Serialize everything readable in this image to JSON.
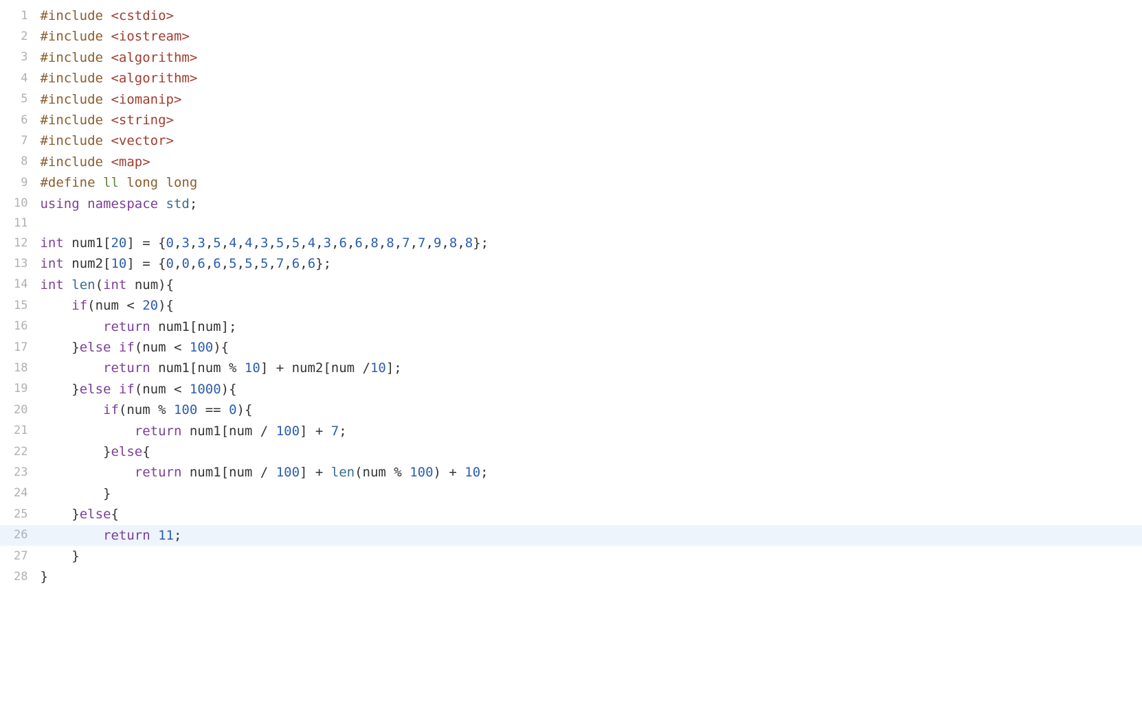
{
  "highlighted_line": 26,
  "lines": [
    {
      "n": 1,
      "tokens": [
        {
          "c": "tok-pp",
          "t": "#include "
        },
        {
          "c": "tok-inc",
          "t": "<cstdio>"
        }
      ]
    },
    {
      "n": 2,
      "tokens": [
        {
          "c": "tok-pp",
          "t": "#include "
        },
        {
          "c": "tok-inc",
          "t": "<iostream>"
        }
      ]
    },
    {
      "n": 3,
      "tokens": [
        {
          "c": "tok-pp",
          "t": "#include "
        },
        {
          "c": "tok-inc",
          "t": "<algorithm>"
        }
      ]
    },
    {
      "n": 4,
      "tokens": [
        {
          "c": "tok-pp",
          "t": "#include "
        },
        {
          "c": "tok-inc",
          "t": "<algorithm>"
        }
      ]
    },
    {
      "n": 5,
      "tokens": [
        {
          "c": "tok-pp",
          "t": "#include "
        },
        {
          "c": "tok-inc",
          "t": "<iomanip>"
        }
      ]
    },
    {
      "n": 6,
      "tokens": [
        {
          "c": "tok-pp",
          "t": "#include "
        },
        {
          "c": "tok-inc",
          "t": "<string>"
        }
      ]
    },
    {
      "n": 7,
      "tokens": [
        {
          "c": "tok-pp",
          "t": "#include "
        },
        {
          "c": "tok-inc",
          "t": "<vector>"
        }
      ]
    },
    {
      "n": 8,
      "tokens": [
        {
          "c": "tok-pp",
          "t": "#include "
        },
        {
          "c": "tok-inc",
          "t": "<map>"
        }
      ]
    },
    {
      "n": 9,
      "tokens": [
        {
          "c": "tok-pp",
          "t": "#define "
        },
        {
          "c": "tok-def",
          "t": "ll "
        },
        {
          "c": "tok-pp",
          "t": "long long"
        }
      ]
    },
    {
      "n": 10,
      "tokens": [
        {
          "c": "tok-kw",
          "t": "using"
        },
        {
          "c": "tok-id",
          "t": " "
        },
        {
          "c": "tok-kw",
          "t": "namespace"
        },
        {
          "c": "tok-id",
          "t": " "
        },
        {
          "c": "tok-fn",
          "t": "std"
        },
        {
          "c": "tok-punc",
          "t": ";"
        }
      ]
    },
    {
      "n": 11,
      "tokens": []
    },
    {
      "n": 12,
      "tokens": [
        {
          "c": "tok-type",
          "t": "int"
        },
        {
          "c": "tok-id",
          "t": " num1["
        },
        {
          "c": "tok-num",
          "t": "20"
        },
        {
          "c": "tok-id",
          "t": "] = {"
        },
        {
          "c": "tok-num",
          "t": "0"
        },
        {
          "c": "tok-punc",
          "t": ","
        },
        {
          "c": "tok-num",
          "t": "3"
        },
        {
          "c": "tok-punc",
          "t": ","
        },
        {
          "c": "tok-num",
          "t": "3"
        },
        {
          "c": "tok-punc",
          "t": ","
        },
        {
          "c": "tok-num",
          "t": "5"
        },
        {
          "c": "tok-punc",
          "t": ","
        },
        {
          "c": "tok-num",
          "t": "4"
        },
        {
          "c": "tok-punc",
          "t": ","
        },
        {
          "c": "tok-num",
          "t": "4"
        },
        {
          "c": "tok-punc",
          "t": ","
        },
        {
          "c": "tok-num",
          "t": "3"
        },
        {
          "c": "tok-punc",
          "t": ","
        },
        {
          "c": "tok-num",
          "t": "5"
        },
        {
          "c": "tok-punc",
          "t": ","
        },
        {
          "c": "tok-num",
          "t": "5"
        },
        {
          "c": "tok-punc",
          "t": ","
        },
        {
          "c": "tok-num",
          "t": "4"
        },
        {
          "c": "tok-punc",
          "t": ","
        },
        {
          "c": "tok-num",
          "t": "3"
        },
        {
          "c": "tok-punc",
          "t": ","
        },
        {
          "c": "tok-num",
          "t": "6"
        },
        {
          "c": "tok-punc",
          "t": ","
        },
        {
          "c": "tok-num",
          "t": "6"
        },
        {
          "c": "tok-punc",
          "t": ","
        },
        {
          "c": "tok-num",
          "t": "8"
        },
        {
          "c": "tok-punc",
          "t": ","
        },
        {
          "c": "tok-num",
          "t": "8"
        },
        {
          "c": "tok-punc",
          "t": ","
        },
        {
          "c": "tok-num",
          "t": "7"
        },
        {
          "c": "tok-punc",
          "t": ","
        },
        {
          "c": "tok-num",
          "t": "7"
        },
        {
          "c": "tok-punc",
          "t": ","
        },
        {
          "c": "tok-num",
          "t": "9"
        },
        {
          "c": "tok-punc",
          "t": ","
        },
        {
          "c": "tok-num",
          "t": "8"
        },
        {
          "c": "tok-punc",
          "t": ","
        },
        {
          "c": "tok-num",
          "t": "8"
        },
        {
          "c": "tok-id",
          "t": "};"
        }
      ]
    },
    {
      "n": 13,
      "tokens": [
        {
          "c": "tok-type",
          "t": "int"
        },
        {
          "c": "tok-id",
          "t": " num2["
        },
        {
          "c": "tok-num",
          "t": "10"
        },
        {
          "c": "tok-id",
          "t": "] = {"
        },
        {
          "c": "tok-num",
          "t": "0"
        },
        {
          "c": "tok-punc",
          "t": ","
        },
        {
          "c": "tok-num",
          "t": "0"
        },
        {
          "c": "tok-punc",
          "t": ","
        },
        {
          "c": "tok-num",
          "t": "6"
        },
        {
          "c": "tok-punc",
          "t": ","
        },
        {
          "c": "tok-num",
          "t": "6"
        },
        {
          "c": "tok-punc",
          "t": ","
        },
        {
          "c": "tok-num",
          "t": "5"
        },
        {
          "c": "tok-punc",
          "t": ","
        },
        {
          "c": "tok-num",
          "t": "5"
        },
        {
          "c": "tok-punc",
          "t": ","
        },
        {
          "c": "tok-num",
          "t": "5"
        },
        {
          "c": "tok-punc",
          "t": ","
        },
        {
          "c": "tok-num",
          "t": "7"
        },
        {
          "c": "tok-punc",
          "t": ","
        },
        {
          "c": "tok-num",
          "t": "6"
        },
        {
          "c": "tok-punc",
          "t": ","
        },
        {
          "c": "tok-num",
          "t": "6"
        },
        {
          "c": "tok-id",
          "t": "};"
        }
      ]
    },
    {
      "n": 14,
      "tokens": [
        {
          "c": "tok-type",
          "t": "int"
        },
        {
          "c": "tok-id",
          "t": " "
        },
        {
          "c": "tok-fn",
          "t": "len"
        },
        {
          "c": "tok-id",
          "t": "("
        },
        {
          "c": "tok-type",
          "t": "int"
        },
        {
          "c": "tok-id",
          "t": " num){"
        }
      ]
    },
    {
      "n": 15,
      "tokens": [
        {
          "c": "tok-id",
          "t": "    "
        },
        {
          "c": "tok-kw",
          "t": "if"
        },
        {
          "c": "tok-id",
          "t": "(num < "
        },
        {
          "c": "tok-num",
          "t": "20"
        },
        {
          "c": "tok-id",
          "t": "){"
        }
      ]
    },
    {
      "n": 16,
      "tokens": [
        {
          "c": "tok-id",
          "t": "        "
        },
        {
          "c": "tok-kw",
          "t": "return"
        },
        {
          "c": "tok-id",
          "t": " num1[num];"
        }
      ]
    },
    {
      "n": 17,
      "tokens": [
        {
          "c": "tok-id",
          "t": "    }"
        },
        {
          "c": "tok-kw",
          "t": "else"
        },
        {
          "c": "tok-id",
          "t": " "
        },
        {
          "c": "tok-kw",
          "t": "if"
        },
        {
          "c": "tok-id",
          "t": "(num < "
        },
        {
          "c": "tok-num",
          "t": "100"
        },
        {
          "c": "tok-id",
          "t": "){"
        }
      ]
    },
    {
      "n": 18,
      "tokens": [
        {
          "c": "tok-id",
          "t": "        "
        },
        {
          "c": "tok-kw",
          "t": "return"
        },
        {
          "c": "tok-id",
          "t": " num1[num % "
        },
        {
          "c": "tok-num",
          "t": "10"
        },
        {
          "c": "tok-id",
          "t": "] + num2[num /"
        },
        {
          "c": "tok-num",
          "t": "10"
        },
        {
          "c": "tok-id",
          "t": "];"
        }
      ]
    },
    {
      "n": 19,
      "tokens": [
        {
          "c": "tok-id",
          "t": "    }"
        },
        {
          "c": "tok-kw",
          "t": "else"
        },
        {
          "c": "tok-id",
          "t": " "
        },
        {
          "c": "tok-kw",
          "t": "if"
        },
        {
          "c": "tok-id",
          "t": "(num < "
        },
        {
          "c": "tok-num",
          "t": "1000"
        },
        {
          "c": "tok-id",
          "t": "){"
        }
      ]
    },
    {
      "n": 20,
      "tokens": [
        {
          "c": "tok-id",
          "t": "        "
        },
        {
          "c": "tok-kw",
          "t": "if"
        },
        {
          "c": "tok-id",
          "t": "(num % "
        },
        {
          "c": "tok-num",
          "t": "100"
        },
        {
          "c": "tok-id",
          "t": " == "
        },
        {
          "c": "tok-num",
          "t": "0"
        },
        {
          "c": "tok-id",
          "t": "){"
        }
      ]
    },
    {
      "n": 21,
      "tokens": [
        {
          "c": "tok-id",
          "t": "            "
        },
        {
          "c": "tok-kw",
          "t": "return"
        },
        {
          "c": "tok-id",
          "t": " num1[num / "
        },
        {
          "c": "tok-num",
          "t": "100"
        },
        {
          "c": "tok-id",
          "t": "] + "
        },
        {
          "c": "tok-num",
          "t": "7"
        },
        {
          "c": "tok-id",
          "t": ";"
        }
      ]
    },
    {
      "n": 22,
      "tokens": [
        {
          "c": "tok-id",
          "t": "        }"
        },
        {
          "c": "tok-kw",
          "t": "else"
        },
        {
          "c": "tok-id",
          "t": "{"
        }
      ]
    },
    {
      "n": 23,
      "tokens": [
        {
          "c": "tok-id",
          "t": "            "
        },
        {
          "c": "tok-kw",
          "t": "return"
        },
        {
          "c": "tok-id",
          "t": " num1[num / "
        },
        {
          "c": "tok-num",
          "t": "100"
        },
        {
          "c": "tok-id",
          "t": "] + "
        },
        {
          "c": "tok-fn",
          "t": "len"
        },
        {
          "c": "tok-id",
          "t": "(num % "
        },
        {
          "c": "tok-num",
          "t": "100"
        },
        {
          "c": "tok-id",
          "t": ") + "
        },
        {
          "c": "tok-num",
          "t": "10"
        },
        {
          "c": "tok-id",
          "t": ";"
        }
      ]
    },
    {
      "n": 24,
      "tokens": [
        {
          "c": "tok-id",
          "t": "        }"
        }
      ]
    },
    {
      "n": 25,
      "tokens": [
        {
          "c": "tok-id",
          "t": "    }"
        },
        {
          "c": "tok-kw",
          "t": "else"
        },
        {
          "c": "tok-id",
          "t": "{"
        }
      ]
    },
    {
      "n": 26,
      "tokens": [
        {
          "c": "tok-id",
          "t": "        "
        },
        {
          "c": "tok-kw",
          "t": "return"
        },
        {
          "c": "tok-id",
          "t": " "
        },
        {
          "c": "tok-num",
          "t": "11"
        },
        {
          "c": "tok-id",
          "t": ";"
        }
      ]
    },
    {
      "n": 27,
      "tokens": [
        {
          "c": "tok-id",
          "t": "    }"
        }
      ]
    },
    {
      "n": 28,
      "tokens": [
        {
          "c": "tok-id",
          "t": "}"
        }
      ]
    }
  ]
}
